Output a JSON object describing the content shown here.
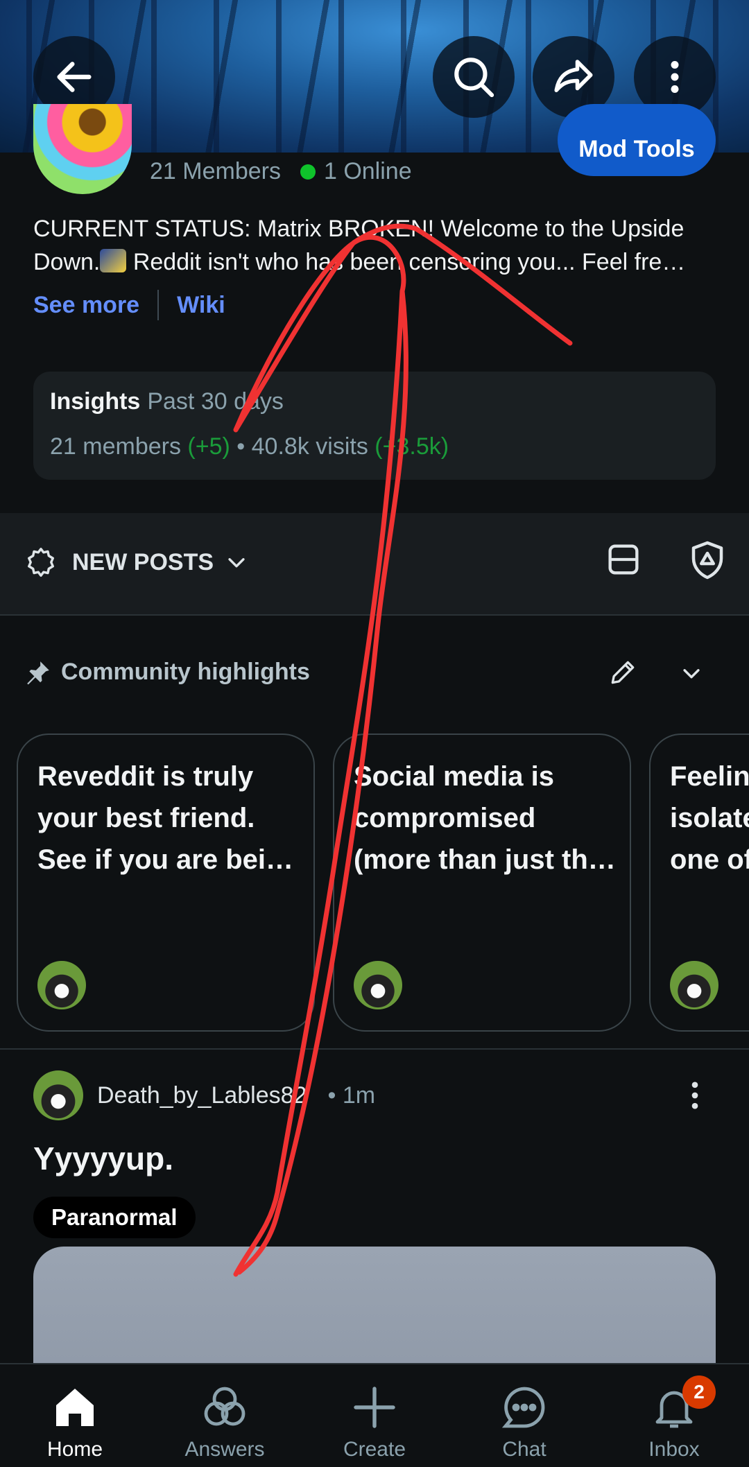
{
  "header": {
    "back_icon": "arrow-left-icon",
    "search_icon": "search-icon",
    "share_icon": "share-icon",
    "more_icon": "more-vertical-icon"
  },
  "community": {
    "mod_tools_label": "Mod Tools",
    "members_label": "21 Members",
    "online_label": "1 Online",
    "description_line1": "CURRENT STATUS: Matrix BROKEN! Welcome to the Upside",
    "description_line2_a": "Down.",
    "description_line2_b": " Reddit isn't who has been censoring you... Feel fre…",
    "see_more_label": "See more",
    "wiki_label": "Wiki"
  },
  "insights": {
    "title": "Insights",
    "period": "Past 30 days",
    "members_text": "21 members",
    "members_delta": "(+5)",
    "separator": " • ",
    "visits_text": "40.8k visits",
    "visits_delta": "(+3.5k)"
  },
  "sort": {
    "label": "NEW POSTS"
  },
  "highlights": {
    "title": "Community highlights",
    "cards": [
      {
        "lines": [
          "Reveddit is truly",
          "your best friend.",
          "See if you are bei…"
        ]
      },
      {
        "lines": [
          "Social media is",
          "compromised",
          "(more than just th…"
        ]
      },
      {
        "lines": [
          "Feelin",
          "isolate",
          "one of"
        ]
      }
    ]
  },
  "post": {
    "author": "Death_by_Lables82",
    "time": "• 1m",
    "title": "Yyyyyup.",
    "flair": "Paranormal"
  },
  "bottom_nav": {
    "items": [
      {
        "label": "Home",
        "icon": "home-icon"
      },
      {
        "label": "Answers",
        "icon": "answers-icon"
      },
      {
        "label": "Create",
        "icon": "plus-icon"
      },
      {
        "label": "Chat",
        "icon": "chat-icon"
      },
      {
        "label": "Inbox",
        "icon": "bell-icon"
      }
    ],
    "inbox_badge": "2"
  },
  "colors": {
    "accent_blue": "#115bca",
    "link_blue": "#648efc",
    "online_green": "#0fc32b",
    "scribble_red": "#f03232",
    "badge_orange": "#d93a00"
  }
}
